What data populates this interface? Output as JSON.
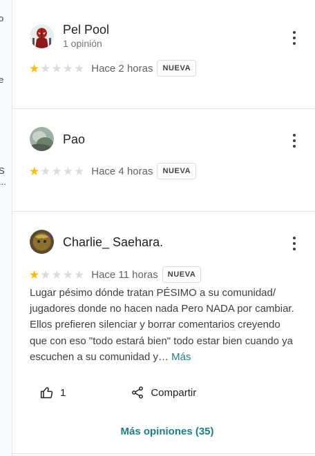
{
  "sidebar_fragments": [
    "o",
    "e",
    "S",
    "..."
  ],
  "reviews": [
    {
      "name": "Pel Pool",
      "subtitle": "1 opinión",
      "rating": 1,
      "time": "Hace 2 horas",
      "badge": "NUEVA",
      "text": "",
      "more": ""
    },
    {
      "name": "Pao",
      "subtitle": "",
      "rating": 1,
      "time": "Hace 4 horas",
      "badge": "NUEVA",
      "text": "",
      "more": ""
    },
    {
      "name": "Charlie_ Saehara.",
      "subtitle": "",
      "rating": 1,
      "time": "Hace 11 horas",
      "badge": "NUEVA",
      "text": "Lugar pésimo dónde tratan PÉSIMO a su comunidad/ jugadores donde no hacen nada Pero NADA por cambiar. Ellos prefieren silenciar y borrar comentarios creyendo que con eso \"todo estará bien\" todo estar bien cuando ya escuchen a su comunidad y…",
      "more": "Más"
    }
  ],
  "actions": {
    "like_count": "1",
    "share_label": "Compartir"
  },
  "more_reviews_label": "Más opiniones (35)",
  "colors": {
    "star_on": "#fbbc04",
    "star_off": "#dadce0",
    "link": "#1a7f8a"
  },
  "icons": [
    "thumbs-up-icon",
    "share-icon",
    "more-vert-icon",
    "star-icon"
  ]
}
